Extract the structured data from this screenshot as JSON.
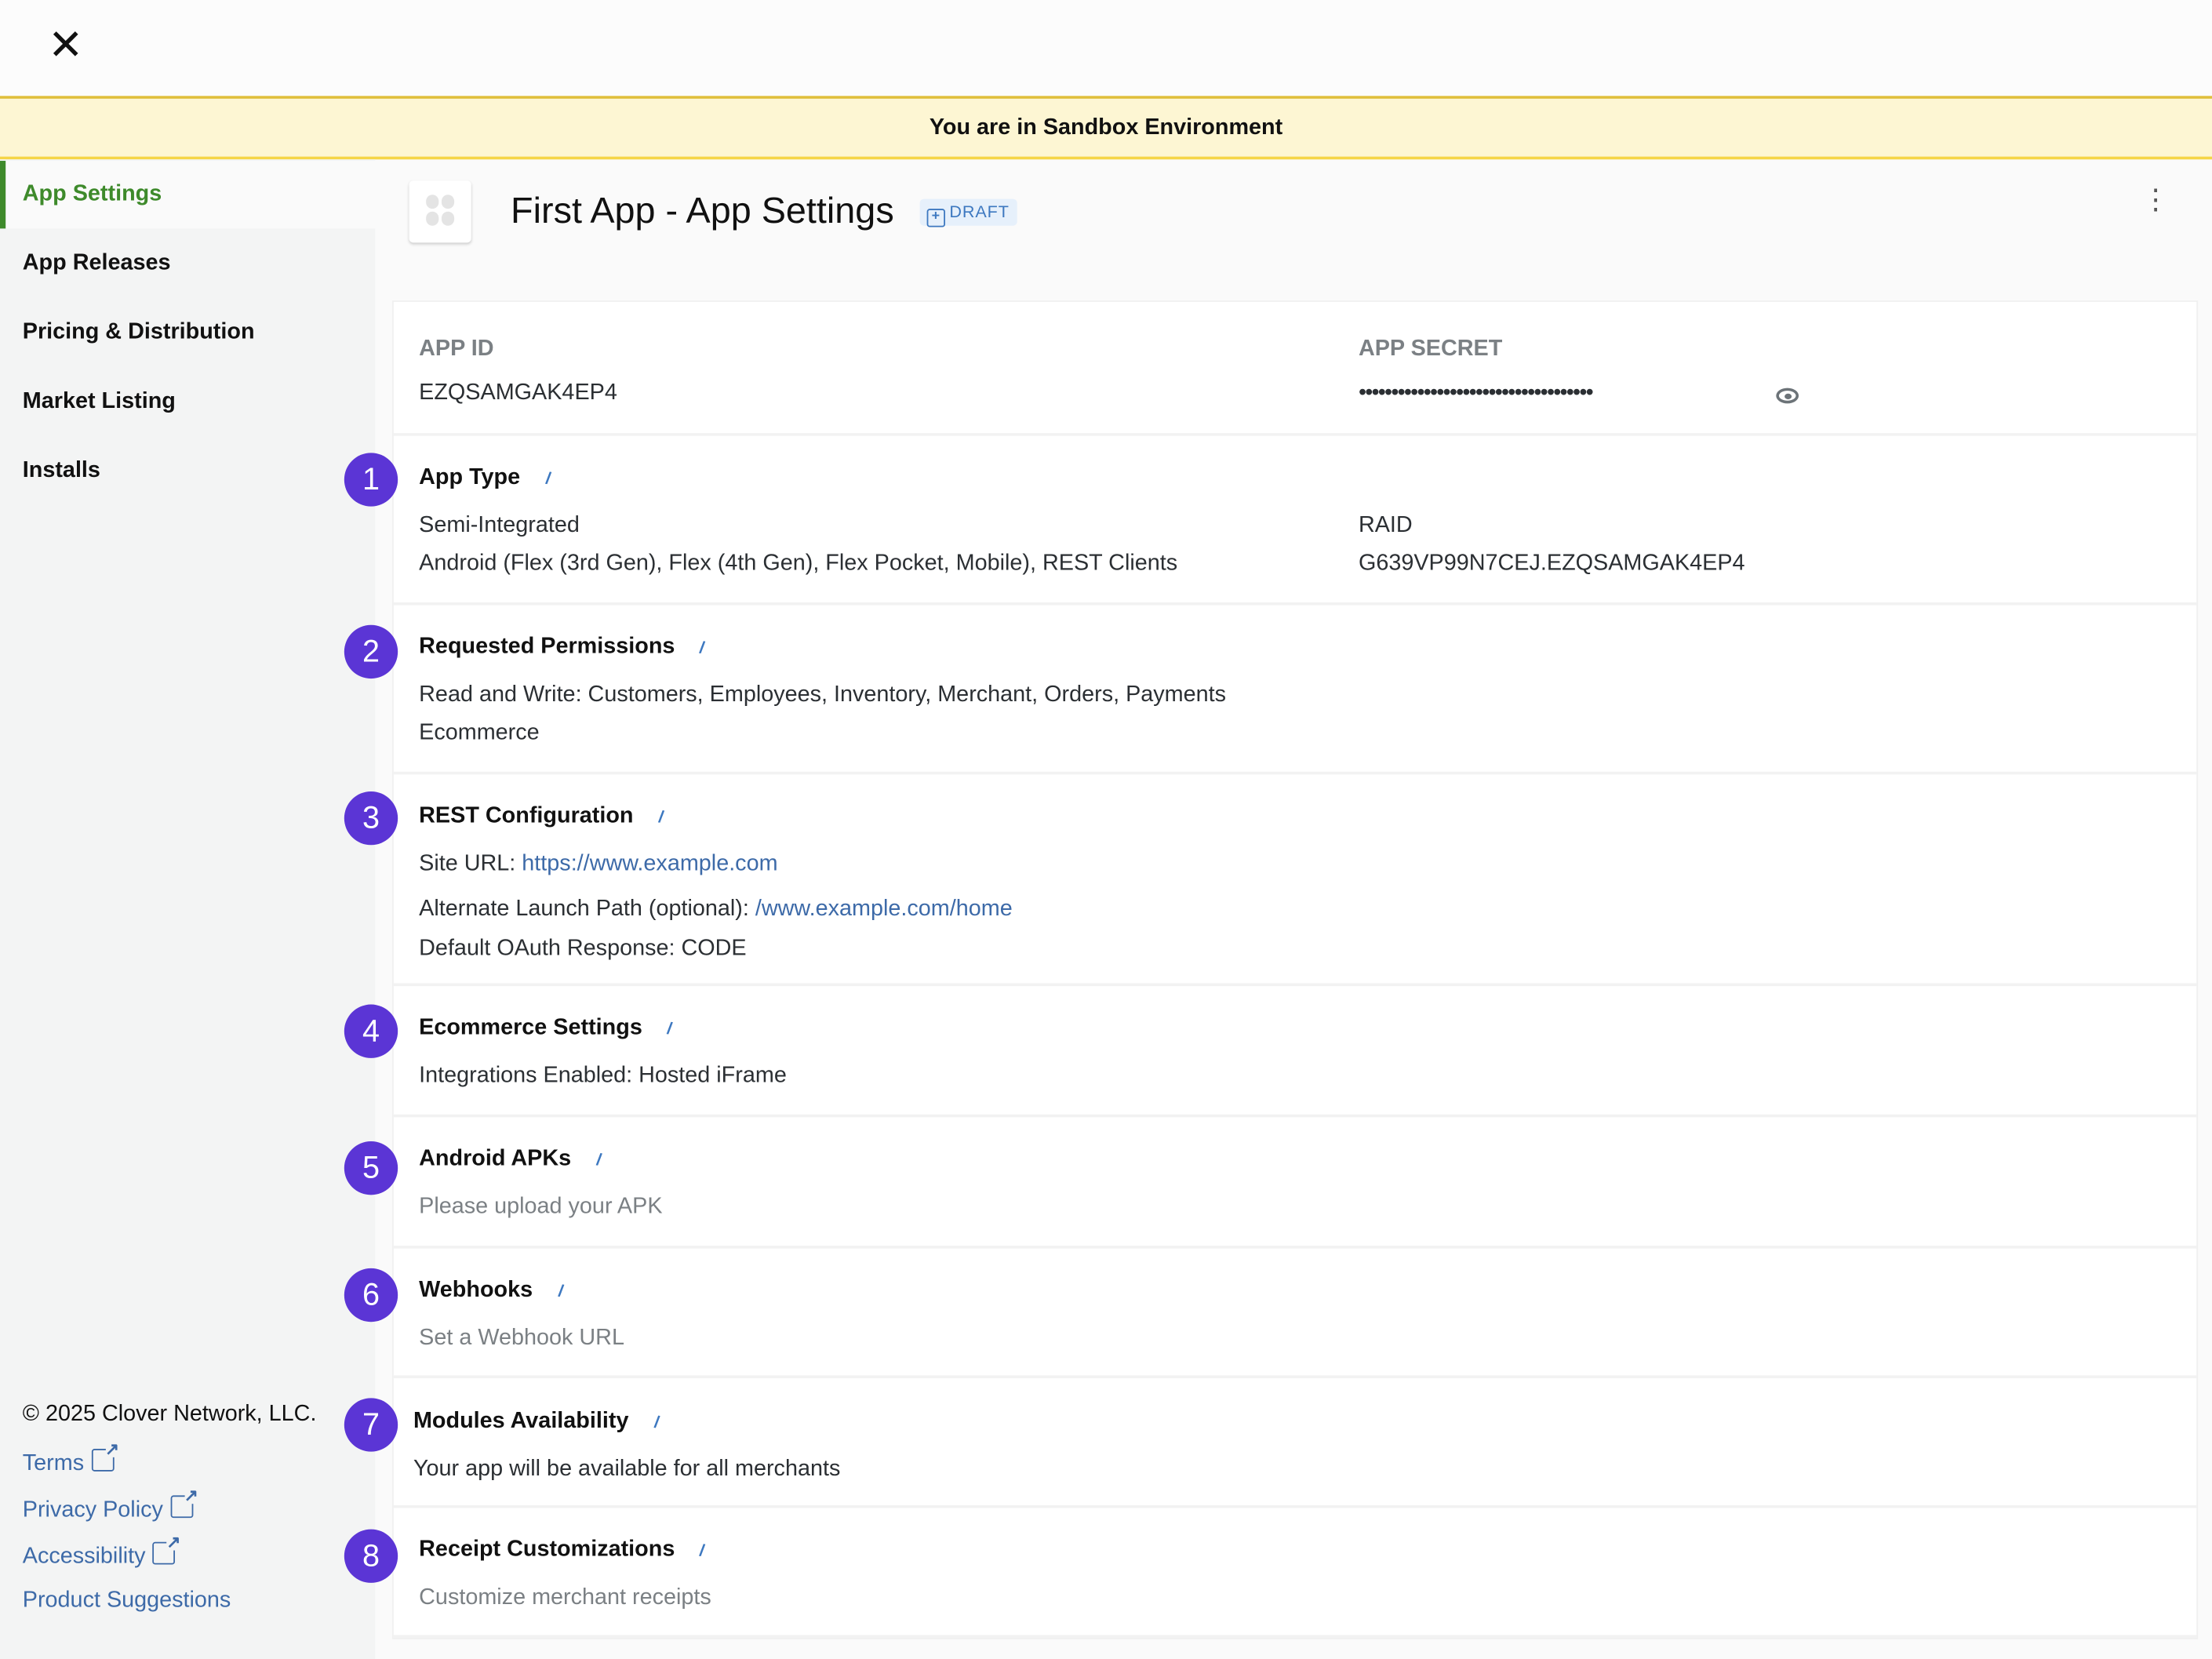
{
  "topbar": {
    "close_icon": "close-icon"
  },
  "banner": {
    "text": "You are in Sandbox Environment"
  },
  "sidebar": {
    "items": [
      {
        "label": "App Settings",
        "active": true
      },
      {
        "label": "App Releases"
      },
      {
        "label": "Pricing & Distribution"
      },
      {
        "label": "Market Listing"
      },
      {
        "label": "Installs"
      }
    ],
    "footer": {
      "copyright": "© 2025 Clover Network, LLC.",
      "links": [
        "Terms",
        "Privacy Policy",
        "Accessibility",
        "Product Suggestions"
      ]
    }
  },
  "header": {
    "title": "First App - App Settings",
    "badge": "DRAFT"
  },
  "credentials": {
    "app_id_label": "APP ID",
    "app_id": "EZQSAMGAK4EP4",
    "app_secret_label": "APP SECRET",
    "app_secret": "••••••••••••••••••••••••••••••••••••"
  },
  "sections": [
    {
      "num": "1",
      "title": "App Type",
      "lines": [
        "Semi-Integrated",
        "Android (Flex (3rd Gen), Flex (4th Gen), Flex Pocket, Mobile), REST Clients"
      ],
      "right": [
        "RAID",
        "G639VP99N7CEJ.EZQSAMGAK4EP4"
      ]
    },
    {
      "num": "2",
      "title": "Requested Permissions",
      "lines": [
        "Read and Write: Customers, Employees, Inventory, Merchant, Orders, Payments",
        "Ecommerce"
      ]
    },
    {
      "num": "3",
      "title": "REST Configuration",
      "site_label": "Site URL: ",
      "site_url": "https://www.example.com",
      "alt_label": "Alternate Launch Path (optional): ",
      "alt_url": "/www.example.com/home",
      "oauth": "Default OAuth Response: CODE"
    },
    {
      "num": "4",
      "title": "Ecommerce Settings",
      "lines": [
        "Integrations Enabled: Hosted iFrame"
      ]
    },
    {
      "num": "5",
      "title": "Android APKs",
      "lines": [
        "Please upload your APK"
      ]
    },
    {
      "num": "6",
      "title": "Webhooks",
      "lines": [
        "Set a Webhook URL"
      ]
    },
    {
      "num": "7",
      "title": "Modules Availability",
      "lines": [
        "Your app will be available for all merchants"
      ]
    },
    {
      "num": "8",
      "title": "Receipt Customizations",
      "lines": [
        "Customize merchant receipts"
      ]
    }
  ],
  "colors": {
    "accent_green": "#3e8a2b",
    "badge_purple": "#5b35d5",
    "link_blue": "#3d6aa8",
    "banner_bg": "#fdf6d3"
  }
}
